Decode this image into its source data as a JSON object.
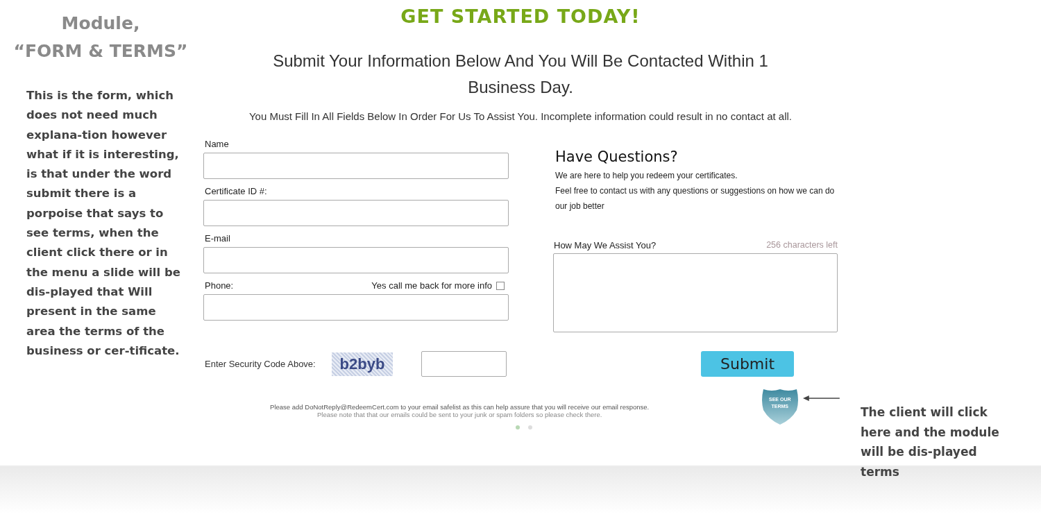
{
  "annotation_left": {
    "title_lines": [
      "Module,",
      "“FORM & TERMS”"
    ],
    "note": "This is the form, which does not need much explana-tion however what if it is interesting, is that under the word submit there is a porpoise that says to see terms, when the client click there or in the menu a slide will be dis-played that Will present in the same area the terms of the business or cer-tificate."
  },
  "heading": "GET STARTED TODAY!",
  "subheading": "Submit Your Information Below And You Will Be Contacted Within 1 Business Day.",
  "instruction": "You Must Fill In All Fields Below In Order For Us To Assist You. Incomplete information could result in no contact at all.",
  "fields": [
    {
      "label": "Name"
    },
    {
      "label": "Certificate ID #:"
    },
    {
      "label": "E-mail"
    },
    {
      "label": "Phone:"
    }
  ],
  "callback": {
    "label": "Yes call me  back for more info",
    "checked": false
  },
  "questions": {
    "title": "Have Questions?",
    "lines": [
      "We are here to help you redeem your certificates.",
      "Feel free to contact us with any questions or suggestions on how we can do our job better"
    ]
  },
  "message": {
    "label": "How May We Assist You?",
    "counter": "256  characters left"
  },
  "security": {
    "label": "Enter Security Code Above:",
    "code": "b2byb"
  },
  "submit": "Submit",
  "terms_badge": [
    "SEE OUR",
    "TERMS"
  ],
  "footer_lines": [
    "Please add DoNotReply@RedeemCert.com to your email safelist as this can help assure that you will receive our email response.",
    "Please note that that our emails could be sent to your junk or spam folders so please check there."
  ],
  "dots": [
    {
      "selected": true
    },
    {
      "selected": false
    }
  ],
  "annotation_right": "The client will click here and the module will be dis-played terms"
}
